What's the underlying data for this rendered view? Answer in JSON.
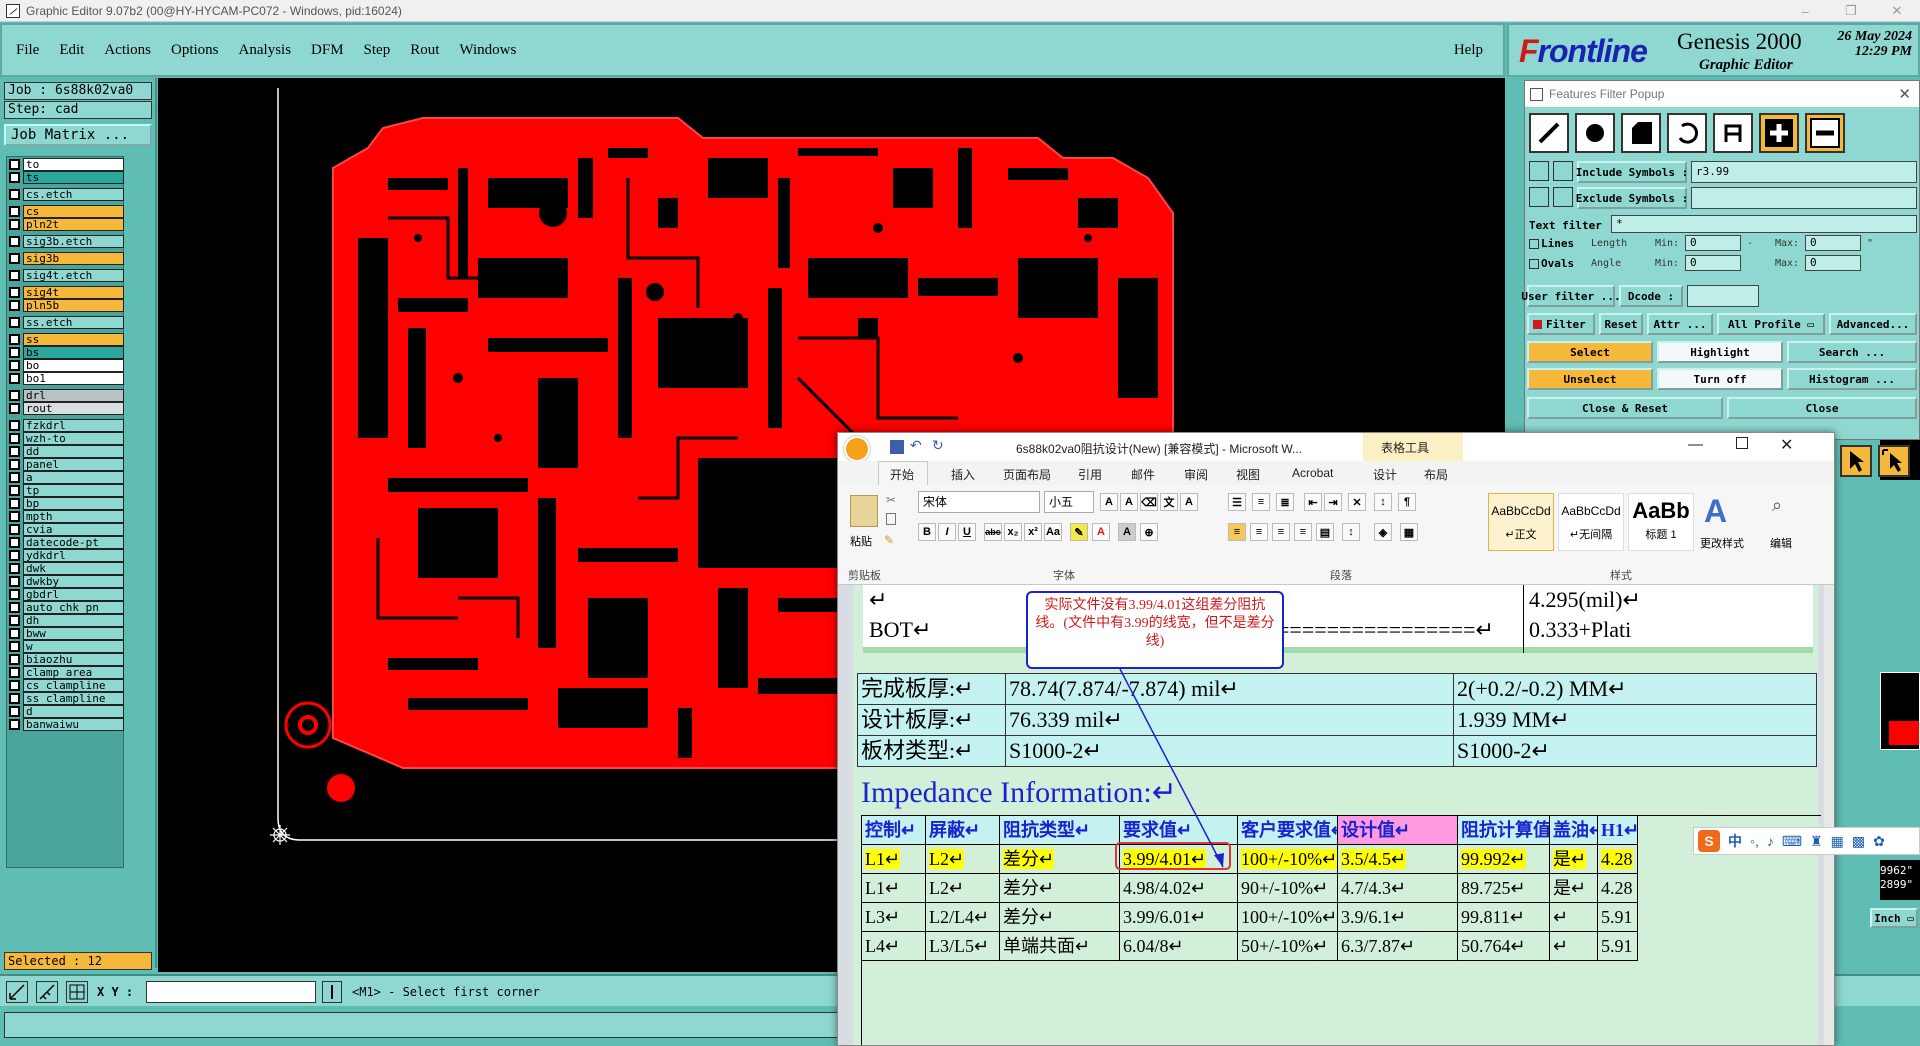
{
  "window": {
    "title": "Graphic Editor 9.07b2 (00@HY-HYCAM-PC072 - Windows, pid:16024)",
    "min": "–",
    "max": "❐",
    "close": "✕"
  },
  "menu": {
    "items": [
      "File",
      "Edit",
      "Actions",
      "Options",
      "Analysis",
      "DFM",
      "Step",
      "Rout",
      "Windows"
    ],
    "help": "Help"
  },
  "brand": {
    "logo_f": "F",
    "logo_rest": "rontline",
    "product": "Genesis 2000",
    "subtitle": "Graphic Editor",
    "date": "26 May 2024",
    "time": "12:29 PM"
  },
  "job": {
    "job_line": "Job : 6s88k02va0",
    "step_line": "Step: cad",
    "job_matrix": "Job Matrix ...",
    "selected": "Selected : 12"
  },
  "layers": [
    {
      "name": "to",
      "color": "#ffffff"
    },
    {
      "name": "ts",
      "color": "#2aa89c"
    },
    {
      "name": "cs.etch",
      "color": "#8fd8d2"
    },
    {
      "name": "cs",
      "color": "#f5b83a"
    },
    {
      "name": "pln2t",
      "color": "#f5b83a"
    },
    {
      "name": "sig3b.etch",
      "color": "#8fd8d2"
    },
    {
      "name": "sig3b",
      "color": "#f5b83a"
    },
    {
      "name": "sig4t.etch",
      "color": "#8fd8d2"
    },
    {
      "name": "sig4t",
      "color": "#f5b83a"
    },
    {
      "name": "pln5b",
      "color": "#f5b83a"
    },
    {
      "name": "ss.etch",
      "color": "#8fd8d2"
    },
    {
      "name": "ss",
      "color": "#f5b83a"
    },
    {
      "name": "bs",
      "color": "#2aa89c"
    },
    {
      "name": "bo",
      "color": "#ffffff"
    },
    {
      "name": "bo1",
      "color": "#ffffff"
    },
    {
      "name": "drl",
      "color": "#b9c2c2"
    },
    {
      "name": "rout",
      "color": "#d8dede"
    },
    {
      "name": "fzkdrl",
      "color": "#8fd8d2"
    },
    {
      "name": "wzh-to",
      "color": "#8fd8d2"
    },
    {
      "name": "dd",
      "color": "#8fd8d2"
    },
    {
      "name": "panel",
      "color": "#8fd8d2"
    },
    {
      "name": "a",
      "color": "#8fd8d2"
    },
    {
      "name": "tp",
      "color": "#8fd8d2"
    },
    {
      "name": "bp",
      "color": "#8fd8d2"
    },
    {
      "name": "mpth",
      "color": "#8fd8d2"
    },
    {
      "name": "cvia",
      "color": "#8fd8d2"
    },
    {
      "name": "datecode-pt",
      "color": "#8fd8d2"
    },
    {
      "name": "ydkdrl",
      "color": "#8fd8d2"
    },
    {
      "name": "dwk",
      "color": "#8fd8d2"
    },
    {
      "name": "dwkby",
      "color": "#8fd8d2"
    },
    {
      "name": "gbdrl",
      "color": "#8fd8d2"
    },
    {
      "name": "auto_chk_pn",
      "color": "#8fd8d2"
    },
    {
      "name": "dh",
      "color": "#8fd8d2"
    },
    {
      "name": "bww",
      "color": "#8fd8d2"
    },
    {
      "name": "w",
      "color": "#8fd8d2"
    },
    {
      "name": "biaozhu",
      "color": "#8fd8d2"
    },
    {
      "name": "clamp_area",
      "color": "#8fd8d2"
    },
    {
      "name": "cs_clampline",
      "color": "#8fd8d2"
    },
    {
      "name": "ss_clampline",
      "color": "#8fd8d2"
    },
    {
      "name": "d",
      "color": "#8fd8d2"
    },
    {
      "name": "banwaiwu",
      "color": "#8fd8d2"
    }
  ],
  "status": {
    "xy_label": "X Y :",
    "message": "<M1> - Select first corner",
    "units": "Inch",
    "coord1": "9962\"",
    "coord2": "2899\""
  },
  "filter": {
    "title": "Features Filter Popup",
    "close": "✕",
    "include_label": "Include Symbols :",
    "include_value": "r3.99",
    "exclude_label": "Exclude Symbols :",
    "exclude_value": "",
    "text_filter_label": "Text filter",
    "text_filter_value": "*",
    "lines_label": "Lines",
    "ovals_label": "Ovals",
    "length_label": "Length",
    "angle_label": "Angle",
    "min_label": "Min:",
    "max_label": "Max:",
    "min1": "0",
    "max1": "0",
    "min2": "0",
    "max2": "0",
    "unit_dash": "-",
    "unit_quote": "\"",
    "user_filter": "User filter ...",
    "dcode_label": "Dcode :",
    "filter_toggle": "Filter",
    "reset": "Reset",
    "attr": "Attr ...",
    "all_profile": "All Profile",
    "advanced": "Advanced...",
    "select": "Select",
    "highlight": "Highlight",
    "search": "Search ...",
    "unselect": "Unselect",
    "turn_off": "Turn off",
    "histogram": "Histogram ...",
    "close_reset": "Close & Reset",
    "close_btn": "Close"
  },
  "word": {
    "title": "6s88k02va0阻抗设计(New) [兼容模式] - Microsoft W...",
    "context_tab": "表格工具",
    "tabs": [
      "开始",
      "插入",
      "页面布局",
      "引用",
      "邮件",
      "审阅",
      "视图",
      "Acrobat",
      "设计",
      "布局"
    ],
    "font_name": "宋体",
    "font_size": "小五",
    "paste": "粘贴",
    "groups": [
      "剪贴板",
      "字体",
      "段落",
      "样式"
    ],
    "styles": [
      {
        "preview": "AaBbCcDd",
        "name": "↵正文"
      },
      {
        "preview": "AaBbCcDd",
        "name": "↵无间隔"
      },
      {
        "preview": "AaBb",
        "name": "标题 1"
      }
    ],
    "change_styles": "更改样式",
    "edit": "编辑",
    "annotation": "实际文件没有3.99/4.01这组差分阻抗线。(文件中有3.99的线宽，但不是差分线)",
    "top_rows": {
      "bot": "BOT↵",
      "arrow": "↵",
      "dashes": "================↵",
      "right1": "4.295(mil)↵",
      "right2": "0.333+Plati"
    },
    "spec_rows": [
      {
        "label": "完成板厚:↵",
        "value": "78.74(7.874/-7.874) mil↵",
        "right": "2(+0.2/-0.2) MM↵"
      },
      {
        "label": "设计板厚:↵",
        "value": "76.339 mil↵",
        "right": "1.939 MM↵"
      },
      {
        "label": "板材类型:↵",
        "value": "S1000-2↵",
        "right": "S1000-2↵"
      }
    ],
    "heading": "Impedance Information:↵",
    "table_headers": [
      "控制↵",
      "屏蔽↵",
      "阻抗类型↵",
      "要求值↵",
      "客户要求值↵",
      "设计值↵",
      "阻抗计算值↵",
      "盖油↵",
      "H1↵"
    ],
    "table_rows": [
      [
        "L1↵",
        "L2↵",
        "差分↵",
        "3.99/4.01↵",
        "100+/-10%↵",
        "3.5/4.5↵",
        "99.992↵",
        "是↵",
        "4.28"
      ],
      [
        "L1↵",
        "L2↵",
        "差分↵",
        "4.98/4.02↵",
        "90+/-10%↵",
        "4.7/4.3↵",
        "89.725↵",
        "是↵",
        "4.28"
      ],
      [
        "L3↵",
        "L2/L4↵",
        "差分↵",
        "3.99/6.01↵",
        "100+/-10%↵",
        "3.9/6.1↵",
        "99.811↵",
        "↵",
        "5.91"
      ],
      [
        "L4↵",
        "L3/L5↵",
        "单端共面↵",
        "6.04/8↵",
        "50+/-10%↵",
        "6.3/7.87↵",
        "50.764↵",
        "↵",
        "5.91"
      ]
    ]
  },
  "ime": {
    "label": "中"
  },
  "colors": {
    "copper": "#ff0000",
    "panel": "#8fd8d2",
    "accent": "#f5b83a"
  }
}
